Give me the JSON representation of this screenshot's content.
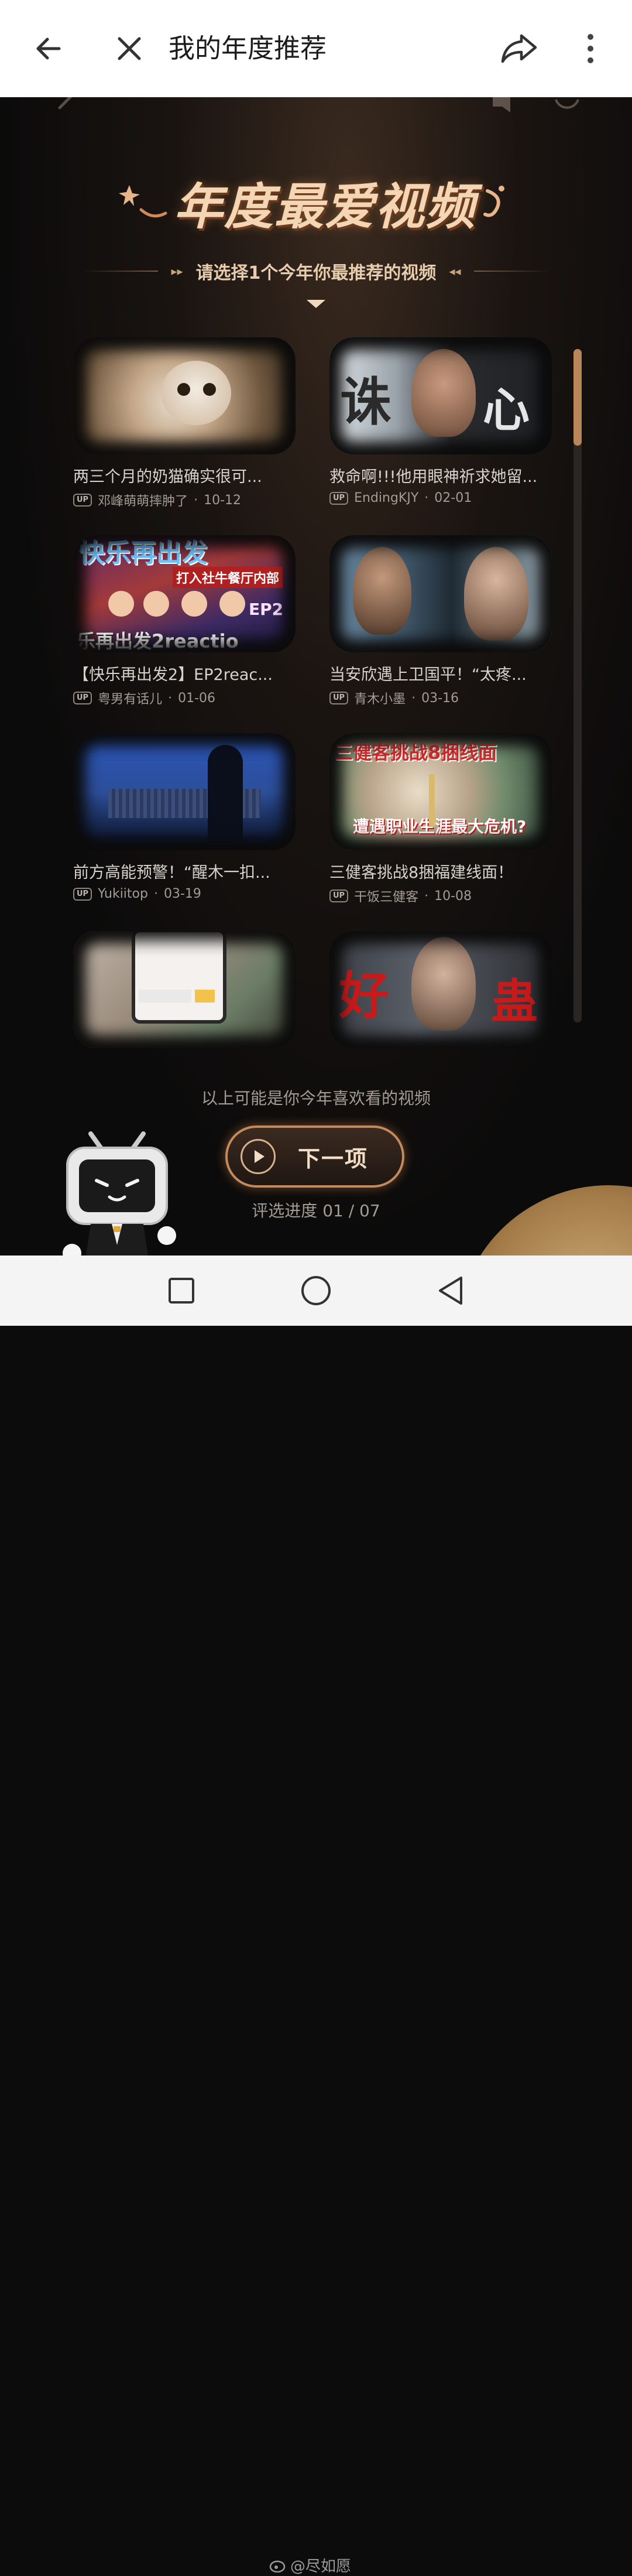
{
  "appbar": {
    "title": "我的年度推荐",
    "icons": [
      "back-arrow-icon",
      "close-icon",
      "share-icon",
      "more-vertical-icon"
    ]
  },
  "main": {
    "banner_title": "年度最爱视频",
    "subtitle": "请选择1个今年你最推荐的视频",
    "videos": [
      {
        "title": "两三个月的奶猫确实很可...",
        "badge": "UP",
        "author": "邓峰萌萌摔肿了",
        "date": "10-12"
      },
      {
        "title": "救命啊!!!他用眼神祈求她留...",
        "badge": "UP",
        "author": "EndingKJY",
        "date": "02-01"
      },
      {
        "title": "【快乐再出发2】EP2reac...",
        "badge": "UP",
        "author": "粤男有话儿",
        "date": "01-06"
      },
      {
        "title": "当安欣遇上卫国平！“太疼...",
        "badge": "UP",
        "author": "青木小墨",
        "date": "03-16"
      },
      {
        "title": "前方高能预警！“醒木一扣...",
        "badge": "UP",
        "author": "Yukiitop",
        "date": "03-19"
      },
      {
        "title": "三健客挑战8捆福建线面！",
        "badge": "UP",
        "author": "干饭三健客",
        "date": "10-08"
      },
      {
        "title": "",
        "badge": "",
        "author": "",
        "date": ""
      },
      {
        "title": "",
        "badge": "",
        "author": "",
        "date": ""
      }
    ],
    "thumb_texts": {
      "t2_left": "诛",
      "t2_right": "心",
      "t3_top": "快乐再出发",
      "t3_caption": "打入社牛餐厅内部",
      "t3_ep": "EP2",
      "t3_bottom": "乐再出发2reactio",
      "t6_top": "三健客挑战8捆线面",
      "t6_bottom": "遭遇职业生涯最大危机?",
      "t8_left": "好",
      "t8_right": "蛊"
    },
    "hint": "以上可能是你今年喜欢看的视频",
    "next_button": "下一项",
    "progress": "评选进度 01 / 07"
  },
  "watermark": "@尽如愿",
  "colors": {
    "accent": "#c38a5c",
    "bg": "#0d0c0c",
    "title_gold": "#f4d6b4"
  }
}
